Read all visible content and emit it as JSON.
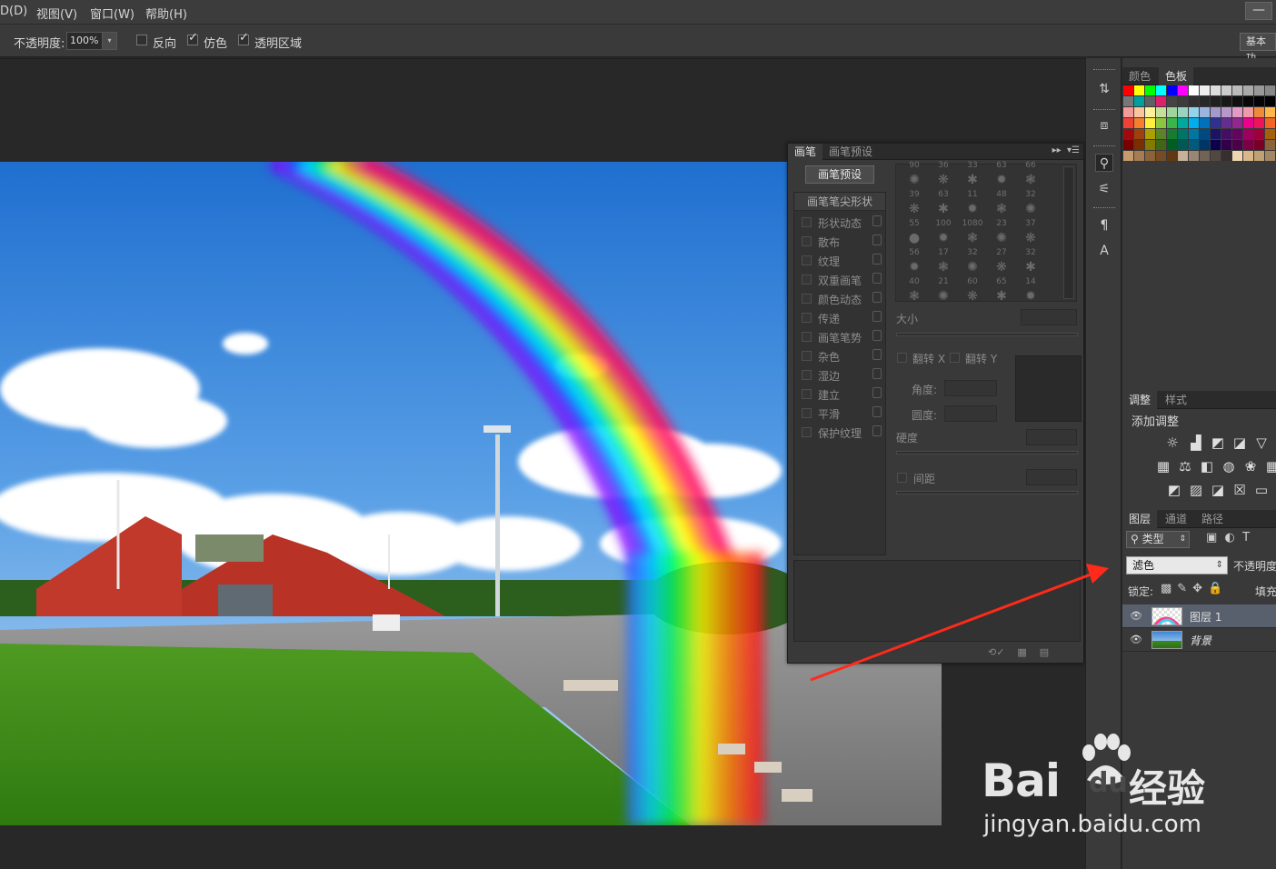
{
  "menubar": {
    "items": [
      "D(D)",
      "视图(V)",
      "窗口(W)",
      "帮助(H)"
    ],
    "minimize": "—"
  },
  "options": {
    "opacity_label": "不透明度:",
    "opacity_value": "100%",
    "reverse_label": "反向",
    "dither_label": "仿色",
    "transparency_label": "透明区域",
    "reverse_checked": false,
    "dither_checked": true,
    "transparency_checked": true,
    "workspace": "基本功"
  },
  "brush_panel": {
    "tabs": [
      "画笔",
      "画笔预设"
    ],
    "preset_button": "画笔预设",
    "tip_header": "画笔笔尖形状",
    "tip_options": [
      "形状动态",
      "散布",
      "纹理",
      "双重画笔",
      "颜色动态",
      "传递",
      "画笔笔势",
      "杂色",
      "湿边",
      "建立",
      "平滑",
      "保护纹理"
    ],
    "brush_sizes": [
      [
        "90",
        "36",
        "33",
        "63",
        "66"
      ],
      [
        "39",
        "63",
        "11",
        "48",
        "32"
      ],
      [
        "55",
        "100",
        "1080",
        "23",
        "37"
      ],
      [
        "56",
        "17",
        "32",
        "27",
        "32"
      ],
      [
        "40",
        "21",
        "60",
        "65",
        "14"
      ]
    ],
    "size_label": "大小",
    "flip_x_label": "翻转 X",
    "flip_y_label": "翻转 Y",
    "angle_label": "角度:",
    "roundness_label": "圆度:",
    "hardness_label": "硬度",
    "spacing_label": "间距"
  },
  "color_panel": {
    "tabs": [
      "颜色",
      "色板"
    ],
    "swatch_rows": [
      [
        "#ff0000",
        "#ffff00",
        "#00ff00",
        "#00ffff",
        "#0000ff",
        "#ff00ff",
        "#ffffff",
        "#eeeeee",
        "#dddddd",
        "#cccccc",
        "#bbbbbb",
        "#aaaaaa",
        "#999999",
        "#888888"
      ],
      [
        "#777777",
        "#00a0a0",
        "#606060",
        "#dd1f6e",
        "#444444",
        "#3c3c3c",
        "#303030",
        "#282828",
        "#202020",
        "#181818",
        "#101010",
        "#080808",
        "#050505",
        "#000000"
      ],
      [
        "#f49a9a",
        "#f7c69c",
        "#fdf29b",
        "#c6e09b",
        "#a0d49d",
        "#9ad4c1",
        "#94d3ec",
        "#9bb6de",
        "#a499cb",
        "#b798c9",
        "#e29bc6",
        "#f09ba9",
        "#ee8a3a",
        "#ffb74a"
      ],
      [
        "#ef4136",
        "#f57f2c",
        "#ffef3a",
        "#8cc63f",
        "#3ab54a",
        "#00a99d",
        "#00aeef",
        "#0072bc",
        "#2e3192",
        "#662d91",
        "#92278f",
        "#ec008c",
        "#ed145b",
        "#f26522"
      ],
      [
        "#9e0b0f",
        "#a0410d",
        "#aba000",
        "#598527",
        "#197b30",
        "#007466",
        "#0076a3",
        "#004a80",
        "#1b1464",
        "#440e62",
        "#630460",
        "#9e005d",
        "#9e0039",
        "#a36209"
      ],
      [
        "#790000",
        "#7b2e00",
        "#827b00",
        "#406618",
        "#005e20",
        "#005952",
        "#005b7f",
        "#003663",
        "#0d004c",
        "#32004b",
        "#4b0049",
        "#7b0046",
        "#7a0026",
        "#8c6239"
      ],
      [
        "#c69c6d",
        "#a67c52",
        "#8c6239",
        "#754c24",
        "#603913",
        "#c7b299",
        "#998675",
        "#736357",
        "#534741",
        "#362f2d",
        "#f0d6b0",
        "#d9b78a",
        "#c0a174",
        "#a38763"
      ]
    ]
  },
  "adjust_panel": {
    "tabs": [
      "调整",
      "样式"
    ],
    "title": "添加调整"
  },
  "layers_panel": {
    "tabs": [
      "图层",
      "通道",
      "路径"
    ],
    "filter": "类型",
    "blend_mode": "滤色",
    "opacity_label": "不透明度",
    "lock_label": "锁定:",
    "fill_label": "填充",
    "layers": [
      {
        "name": "图层 1",
        "selected": true
      },
      {
        "name": "背景",
        "selected": false
      }
    ]
  },
  "watermark": {
    "logo": "Bai",
    "logo2": "du",
    "cn": "经验",
    "url": "jingyan.baidu.com"
  }
}
